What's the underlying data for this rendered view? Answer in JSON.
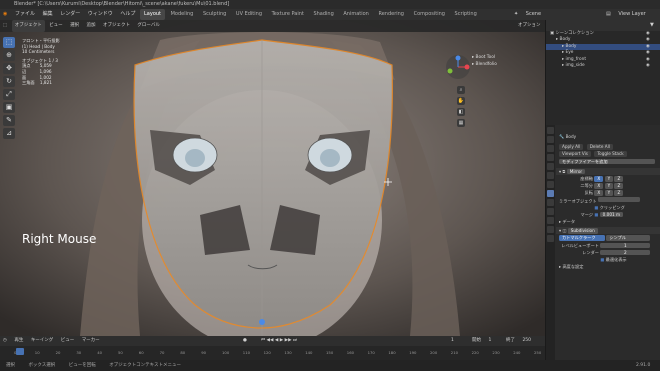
{
  "titlebar": {
    "text": "Blender* [C:\\Users\\Kurumi\\Desktop\\Blender\\Hitomi\\_scene\\akane\\fukeru\\Mu\\01.blend]"
  },
  "menubar": {
    "items": [
      "ファイル",
      "編集",
      "レンダー",
      "ウィンドウ",
      "ヘルプ"
    ],
    "workspaces": [
      "Layout",
      "Modeling",
      "Sculpting",
      "UV Editing",
      "Texture Paint",
      "Shading",
      "Animation",
      "Rendering",
      "Compositing",
      "Scripting"
    ],
    "active_workspace": "Layout",
    "scene_label": "Scene",
    "view_layer_label": "View Layer"
  },
  "viewport": {
    "header": {
      "mode": "オブジェクト",
      "menu_view": "ビュー",
      "menu_select": "選択",
      "menu_add": "追加",
      "menu_object": "オブジェクト",
      "transform": "グローバル",
      "options": "オプション"
    },
    "info": {
      "view": "フロント・平行投影",
      "collection": "(1) Head | Body",
      "ctrl": "10 Centimeters",
      "objects_label": "オブジェクト",
      "objects_value": "1 / 3",
      "verts_label": "頂点",
      "verts_value": "5,059",
      "edges_label": "辺",
      "edges_value": "1,096",
      "faces_label": "面",
      "faces_value": "1,002",
      "tris_label": "三角面",
      "tris_value": "1,821"
    },
    "key_overlay": "Right Mouse",
    "right_tools": [
      "Boot Tool",
      "Blendfolio"
    ],
    "tools": [
      "select-tool",
      "cursor-tool",
      "move-tool",
      "rotate-tool",
      "scale-tool",
      "transform-tool",
      "annotate-tool",
      "measure-tool"
    ],
    "gizmo": {
      "x_color": "#e8454f",
      "y_color": "#7fbf3a",
      "z_color": "#4a8ae8"
    }
  },
  "timeline": {
    "header_items": [
      "再生",
      "キーイング",
      "ビュー",
      "マーカー"
    ],
    "frame_current": "1",
    "start_label": "開始",
    "start": "1",
    "end_label": "終了",
    "end": "250",
    "ticks": [
      "0",
      "10",
      "20",
      "30",
      "40",
      "50",
      "60",
      "70",
      "80",
      "90",
      "100",
      "110",
      "120",
      "130",
      "140",
      "150",
      "160",
      "170",
      "180",
      "190",
      "200",
      "210",
      "220",
      "230",
      "240",
      "250"
    ]
  },
  "statusbar": {
    "items": [
      "選択",
      "ボックス選択",
      "ビューを回転",
      "オブジェクトコンテキストメニュー"
    ],
    "version": "2.91.0"
  },
  "outliner": {
    "rows": [
      {
        "label": "シーンコレクション",
        "indent": 0,
        "selected": false
      },
      {
        "label": "Body",
        "indent": 1,
        "selected": false
      },
      {
        "label": "Body",
        "indent": 2,
        "selected": true
      },
      {
        "label": "Eye",
        "indent": 2,
        "selected": false
      },
      {
        "label": "img_front",
        "indent": 2,
        "selected": false
      },
      {
        "label": "img_side",
        "indent": 2,
        "selected": false
      }
    ]
  },
  "properties": {
    "object_name": "Body",
    "btn_apply_all": "Apply All",
    "btn_delete_all": "Delete All",
    "btn_viewport_vis": "Viewport Vis",
    "btn_toggle_stack": "Toggle Stack",
    "add_modifier": "モディファイアーを追加",
    "mod1_name": "Mirror",
    "axis_label": "座標軸",
    "bisect_label": "二等分",
    "flip_label": "反転",
    "axis_x": "X",
    "axis_y": "Y",
    "axis_z": "Z",
    "mirror_object_label": "ミラーオブジェクト",
    "clipping_label": "クリッピング",
    "merge_label": "マージ",
    "merge_value": "0.001 m",
    "data_label": "データ",
    "mod2_name": "Subdivision",
    "catmull": "カトマルクラーク",
    "simple": "シンプル",
    "levels_viewport_label": "レベルビューポート",
    "levels_viewport": "1",
    "render_label": "レンダー",
    "render_value": "2",
    "optimal_label": "最適化表示",
    "advanced_label": "高度な設定"
  }
}
